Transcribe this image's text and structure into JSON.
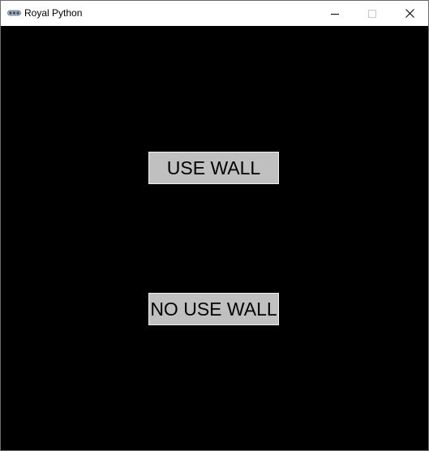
{
  "window": {
    "title": "Royal Python",
    "app_icon": "python-icon",
    "controls": {
      "minimize_icon": "minimize-icon",
      "maximize_icon": "maximize-icon",
      "close_icon": "close-icon"
    }
  },
  "main": {
    "background_color": "#000000",
    "buttons": [
      {
        "label": "USE WALL"
      },
      {
        "label": "NO USE WALL"
      }
    ],
    "button_color": "#c0c0c0"
  }
}
